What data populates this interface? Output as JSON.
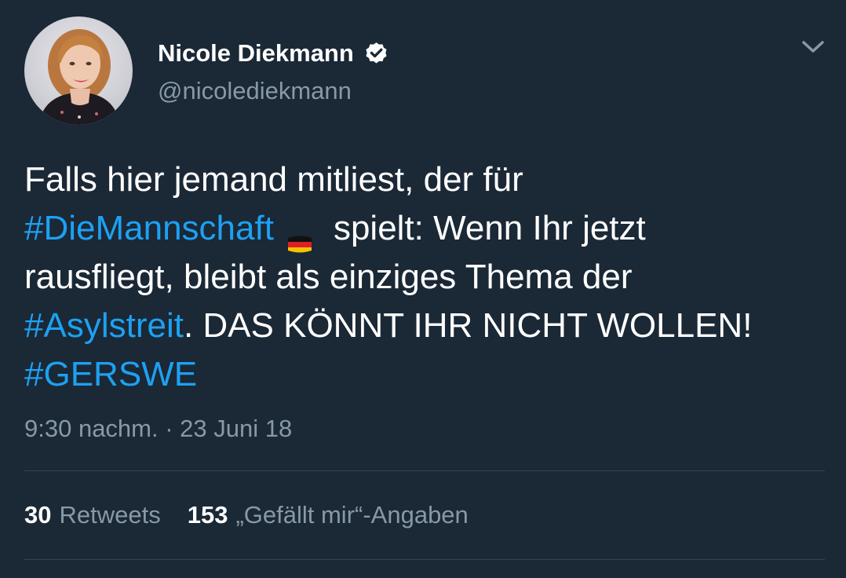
{
  "author": {
    "display_name": "Nicole Diekmann",
    "handle": "@nicolediekmann",
    "verified": true
  },
  "icons": {
    "verified": "verified-badge-icon",
    "menu": "chevron-down-icon",
    "flag": "germany-flag-emoji"
  },
  "tweet": {
    "line1": "Falls hier jemand mitliest, der für",
    "line2_hashtag": "#DieMannschaft",
    "line2_text": "spielt: Wenn Ihr jetzt",
    "line3": "rausfliegt, bleibt als einziges Thema der",
    "line4_hashtag": "#Asylstreit",
    "line4_text": ". DAS KÖNNT IHR NICHT WOLLEN!",
    "line5_hashtag": "#GERSWE"
  },
  "timestamp": "9:30 nachm. · 23 Juni 18",
  "stats": {
    "retweets_count": "30",
    "retweets_label": "Retweets",
    "likes_count": "153",
    "likes_label": "„Gefällt mir“-Angaben"
  },
  "colors": {
    "background": "#1b2836",
    "hashtag": "#1da1f2",
    "secondary_text": "#8899a6",
    "divider": "#38444d"
  }
}
